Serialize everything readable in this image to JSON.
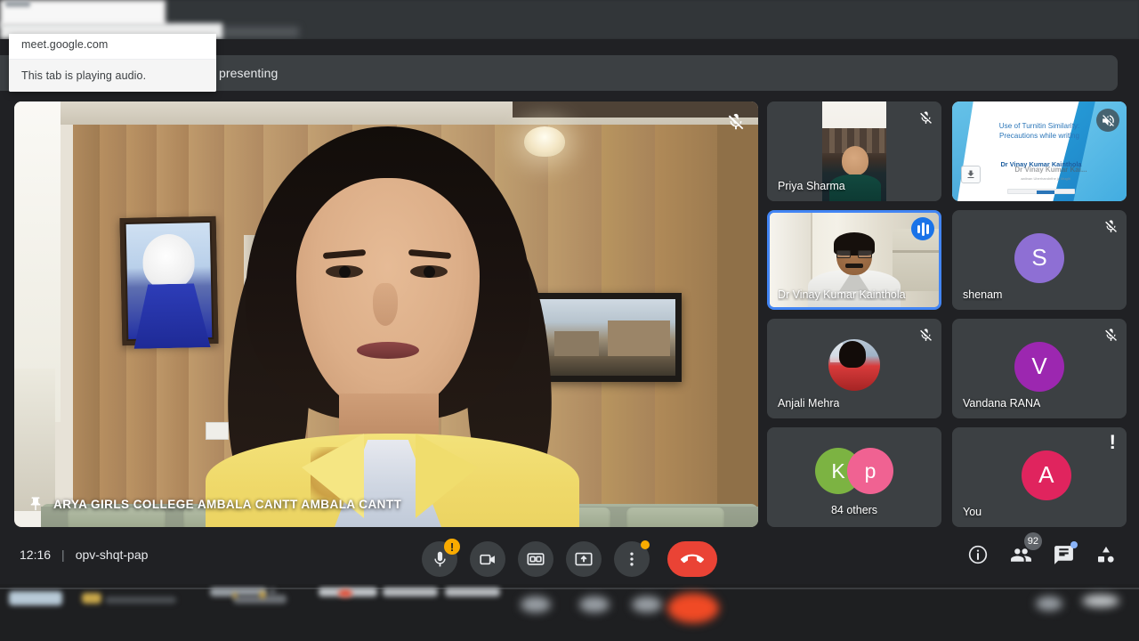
{
  "browser": {
    "tab_popup": {
      "url": "meet.google.com",
      "status": "This tab is playing audio."
    }
  },
  "meet": {
    "header_text": "presenting",
    "main_stage": {
      "caption": "ARYA GIRLS COLLEGE AMBALA CANTT AMBALA CANTT",
      "pin_icon": "pin-icon",
      "mic_icon": "mic-off-icon"
    },
    "participants": [
      {
        "name": "Priya Sharma",
        "type": "video",
        "muted": true,
        "speaking": false
      },
      {
        "name": "",
        "type": "presentation",
        "muted": true,
        "speaking": false,
        "slide": {
          "title_line1": "Use of Turnitin Similarity:",
          "title_line2": "Precautions while writing",
          "author": "Dr Vinay Kumar Kainthola",
          "overlay_text": "Dr Vinay Kumar Kai...",
          "subtext": "aatinan Uberhandnthe ja Muglit"
        }
      },
      {
        "name": "Dr Vinay Kumar Kainthola",
        "type": "video",
        "muted": false,
        "speaking": true
      },
      {
        "name": "shenam",
        "type": "avatar",
        "initial": "S",
        "color": "#8e6fd4",
        "muted": true,
        "speaking": false
      },
      {
        "name": "Anjali Mehra",
        "type": "photo",
        "muted": true,
        "speaking": false
      },
      {
        "name": "Vandana RANA",
        "type": "avatar",
        "initial": "V",
        "color": "#9c27b0",
        "muted": true,
        "speaking": false
      },
      {
        "name": "84 others",
        "type": "group",
        "avatars": [
          {
            "initial": "K",
            "color": "#7cb342"
          },
          {
            "initial": "p",
            "color": "#f06292"
          }
        ],
        "muted": false,
        "speaking": false
      },
      {
        "name": "You",
        "type": "avatar",
        "initial": "A",
        "color": "#e0245e",
        "muted": false,
        "speaking": false,
        "alert": "!"
      }
    ],
    "bottom_bar": {
      "time": "12:16",
      "meeting_code": "opv-shqt-pap",
      "controls": [
        {
          "name": "microphone",
          "icon": "mic-off-icon",
          "badge": "!"
        },
        {
          "name": "camera",
          "icon": "camera-icon",
          "badge": ""
        },
        {
          "name": "captions",
          "icon": "closed-caption-icon",
          "badge": ""
        },
        {
          "name": "present",
          "icon": "present-screen-icon",
          "badge": ""
        },
        {
          "name": "more-options",
          "icon": "more-vertical-icon",
          "badge": "dot"
        }
      ],
      "hangup": {
        "name": "leave-call",
        "icon": "phone-hangup-icon"
      },
      "right_controls": [
        {
          "name": "meeting-details",
          "icon": "info-icon",
          "count": ""
        },
        {
          "name": "participants",
          "icon": "people-icon",
          "count": "92"
        },
        {
          "name": "chat",
          "icon": "chat-icon",
          "count": "",
          "dot": true
        },
        {
          "name": "activities",
          "icon": "activities-icon",
          "count": ""
        }
      ]
    }
  },
  "colors": {
    "accent_blue": "#4285f4",
    "hangup_red": "#ea4335",
    "badge_orange": "#f9ab00",
    "surface": "#3c4043",
    "background": "#202124"
  }
}
